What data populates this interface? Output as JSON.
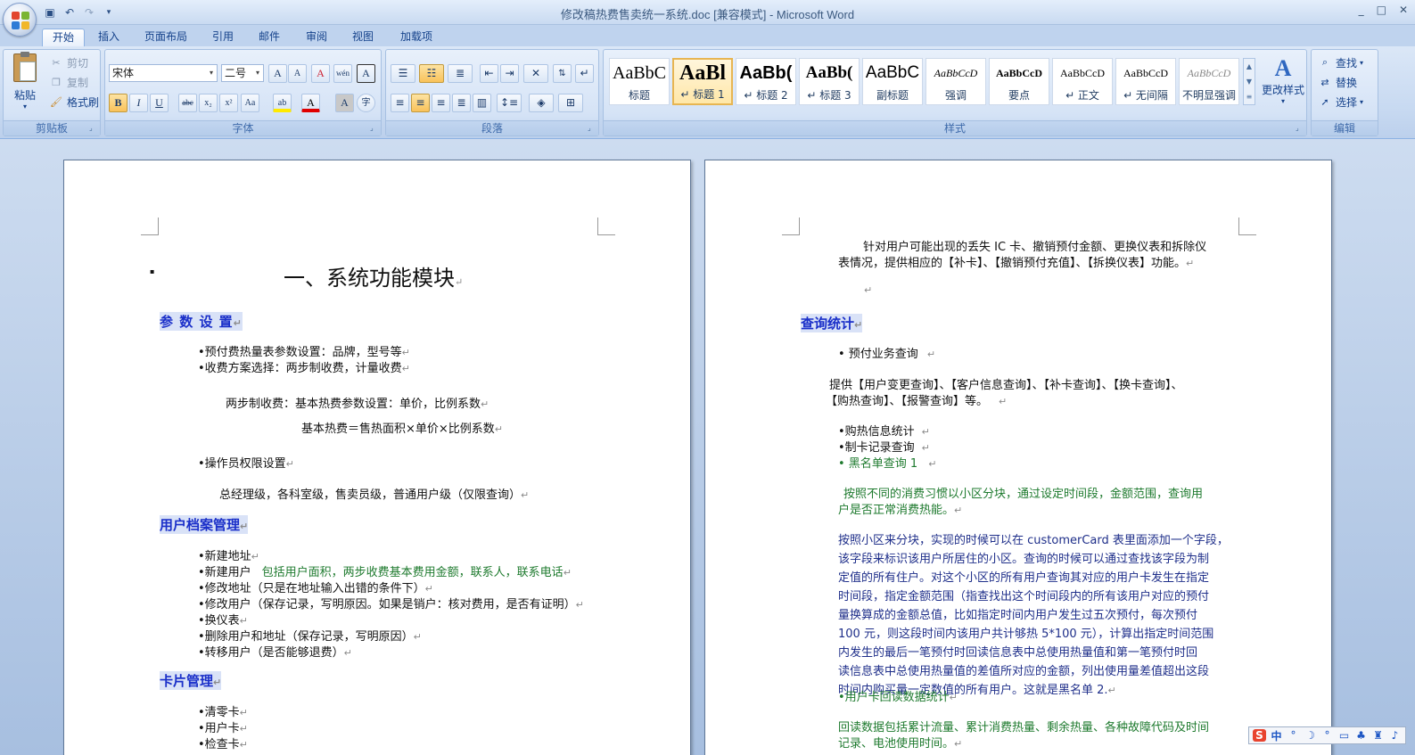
{
  "window": {
    "title": "修改稿热费售卖统一系统.doc [兼容模式] - Microsoft Word",
    "controls": [
      "_",
      "□",
      "✕"
    ]
  },
  "quick_access": {
    "save_glyph": "💾",
    "undo_glyph": "↶",
    "redo_glyph": "↷",
    "more_glyph": "▾"
  },
  "tabs": [
    "开始",
    "插入",
    "页面布局",
    "引用",
    "邮件",
    "审阅",
    "视图",
    "加载项"
  ],
  "ribbon": {
    "clipboard": {
      "label": "剪贴板",
      "paste": "粘贴",
      "cut": "剪切",
      "copy": "复制",
      "format_painter": "格式刷"
    },
    "font": {
      "label": "字体",
      "font_name": "宋体",
      "font_size": "二号",
      "grow": "A",
      "shrink": "A",
      "clear": "A",
      "phonetic": "wén",
      "char_border": "A",
      "bold": "B",
      "italic": "I",
      "underline": "U",
      "strike": "abc",
      "subscript": "x₂",
      "superscript": "x²",
      "change_case": "Aa",
      "highlight": "ab",
      "font_color": "A",
      "char_shading": "A",
      "enclose": "字"
    },
    "paragraph": {
      "label": "段落"
    },
    "styles": {
      "label": "样式",
      "items": [
        {
          "sample": "AaBbC",
          "name": "标题"
        },
        {
          "sample": "AaBl",
          "name": "↵ 标题 1"
        },
        {
          "sample": "AaBb(",
          "name": "↵ 标题 2"
        },
        {
          "sample": "AaBb(",
          "name": "↵ 标题 3"
        },
        {
          "sample": "AaBbC",
          "name": "副标题"
        },
        {
          "sample": "AaBbCcD",
          "name": "强调"
        },
        {
          "sample": "AaBbCcD",
          "name": "要点"
        },
        {
          "sample": "AaBbCcD",
          "name": "↵ 正文"
        },
        {
          "sample": "AaBbCcD",
          "name": "↵ 无间隔"
        },
        {
          "sample": "AaBbCcD",
          "name": "不明显强调"
        }
      ],
      "change_styles": "更改样式"
    },
    "editing": {
      "label": "编辑",
      "find": "查找",
      "replace": "替换",
      "select": "选择"
    }
  },
  "page1": {
    "bullet_mark": "▪",
    "title": "一、系统功能模块",
    "section1": "参 数 设 置",
    "s1_items": [
      "•预付费热量表参数设置：品牌，型号等",
      "•收费方案选择：两步制收费，计量收费"
    ],
    "two_step": "两步制收费：基本热费参数设置：单价，比例系数",
    "formula": "基本热费＝售热面积×单价×比例系数",
    "operator": "•操作员权限设置",
    "roles": "总经理级，各科室级，售卖员级，普通用户级（仅限查询）",
    "section2": "用户档案管理",
    "s2_items": [
      "•新建地址",
      "•新建用户",
      "•修改地址（只是在地址输入出错的条件下）",
      "•修改用户（保存记录，写明原因。如果是销户：核对费用，是否有证明）",
      "•换仪表",
      "•删除用户和地址（保存记录，写明原因）",
      "•转移用户（是否能够退费）"
    ],
    "s2_new_user_note": "包括用户面积，两步收费基本费用金额，联系人，联系电话",
    "section3": "卡片管理",
    "s3_items": [
      "•清零卡",
      "•用户卡",
      "•检查卡"
    ]
  },
  "page2": {
    "intro_line1": "针对用户可能出现的丢失 IC 卡、撤销预付金额、更换仪表和拆除仪",
    "intro_line2": "表情况，提供相应的【补卡】、【撤销预付充值】、【拆换仪表】功能。",
    "section": "查询统计",
    "prepay_query": "• 预付业务查询",
    "provide_line1": "提供【用户变更查询】、【客户信息查询】、【补卡查询】、【换卡查询】、",
    "provide_line2": "【购热查询】、【报警查询】等。",
    "purchase_stats": "•购热信息统计",
    "card_query": "•制卡记录查询",
    "blacklist": "• 黑名单查询 1",
    "green_line1": "按照不同的消费习惯以小区分块，通过设定时间段，金额范围，查询用",
    "green_line2": "户是否正常消费热能。",
    "blue_lines": [
      "按照小区来分块，实现的时候可以在 customerCard 表里面添加一个字段，",
      "该字段来标识该用户所居住的小区。查询的时候可以通过查找该字段为制",
      "定值的所有住户。对这个小区的所有用户查询其对应的用户卡发生在指定",
      "时间段，指定金额范围（指查找出这个时间段内的所有该用户对应的预付",
      "量换算成的金额总值，比如指定时间内用户发生过五次预付，每次预付",
      "100 元，则这段时间内该用户共计够热 5*100 元），计算出指定时间范围",
      "内发生的最后一笔预付时回读信息表中总使用热量值和第一笔预付时回",
      "读信息表中总使用热量值的差值所对应的金额，列出使用量差值超出这段",
      "时间内购买量一定数值的所有用户。这就是黑名单 2."
    ],
    "readback": "•用户卡回读数据统计",
    "readback_line1": "回读数据包括累计流量、累计消费热量、剩余热量、各种故障代码及时间",
    "readback_line2": "记录、电池使用时间。"
  },
  "ime": {
    "logo": "S",
    "lang": "中",
    "items": [
      "°",
      "☽",
      "°",
      "▭",
      "♣",
      "♜",
      "♪"
    ]
  }
}
